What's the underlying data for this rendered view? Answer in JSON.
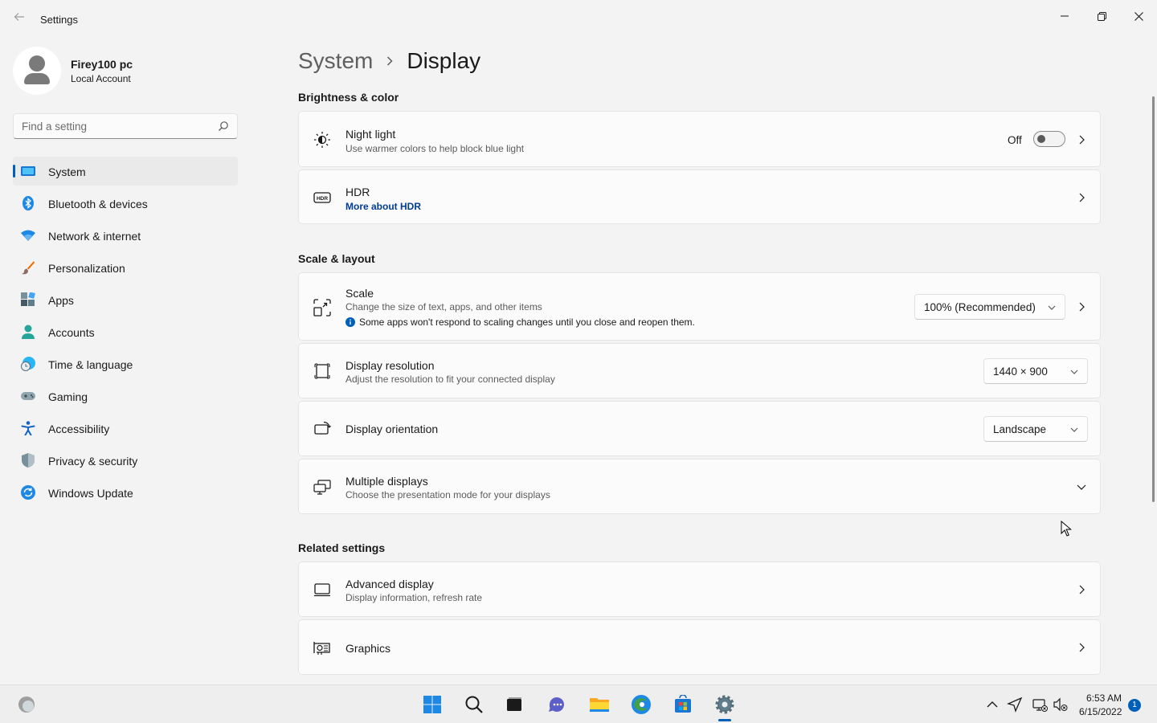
{
  "window": {
    "app_title": "Settings",
    "icons": {
      "back": "back-arrow-icon",
      "minimize": "minimize-icon",
      "maximize": "restore-icon",
      "close": "close-icon"
    }
  },
  "profile": {
    "name": "Firey100 pc",
    "account_type": "Local Account"
  },
  "search": {
    "placeholder": "Find a setting"
  },
  "sidebar": {
    "items": [
      {
        "label": "System",
        "icon": "system-icon",
        "active": true
      },
      {
        "label": "Bluetooth & devices",
        "icon": "bluetooth-icon"
      },
      {
        "label": "Network & internet",
        "icon": "wifi-icon"
      },
      {
        "label": "Personalization",
        "icon": "brush-icon"
      },
      {
        "label": "Apps",
        "icon": "apps-icon"
      },
      {
        "label": "Accounts",
        "icon": "accounts-icon"
      },
      {
        "label": "Time & language",
        "icon": "globe-clock-icon"
      },
      {
        "label": "Gaming",
        "icon": "gamepad-icon"
      },
      {
        "label": "Accessibility",
        "icon": "accessibility-icon"
      },
      {
        "label": "Privacy & security",
        "icon": "shield-icon"
      },
      {
        "label": "Windows Update",
        "icon": "update-icon"
      }
    ]
  },
  "breadcrumb": {
    "parent": "System",
    "current": "Display"
  },
  "sections": {
    "brightness": "Brightness & color",
    "scale_layout": "Scale & layout",
    "related": "Related settings"
  },
  "night_light": {
    "title": "Night light",
    "subtitle": "Use warmer colors to help block blue light",
    "state": "Off",
    "on": false
  },
  "hdr": {
    "title": "HDR",
    "link": "More about HDR"
  },
  "scale": {
    "title": "Scale",
    "subtitle": "Change the size of text, apps, and other items",
    "note": "Some apps won't respond to scaling changes until you close and reopen them.",
    "value": "100% (Recommended)"
  },
  "resolution": {
    "title": "Display resolution",
    "subtitle": "Adjust the resolution to fit your connected display",
    "value": "1440 × 900"
  },
  "orientation": {
    "title": "Display orientation",
    "value": "Landscape"
  },
  "multiple": {
    "title": "Multiple displays",
    "subtitle": "Choose the presentation mode for your displays"
  },
  "advanced": {
    "title": "Advanced display",
    "subtitle": "Display information, refresh rate"
  },
  "graphics": {
    "title": "Graphics"
  },
  "taskbar": {
    "apps": [
      "start-icon",
      "search-icon",
      "task-view-icon",
      "chat-icon",
      "file-explorer-icon",
      "edge-icon",
      "store-icon",
      "settings-icon"
    ],
    "time": "6:53 AM",
    "date": "6/15/2022",
    "notifications": "1"
  },
  "colors": {
    "accent": "#005fb8",
    "link": "#003e92",
    "background": "#f3f3f3",
    "card": "#fbfbfb"
  }
}
